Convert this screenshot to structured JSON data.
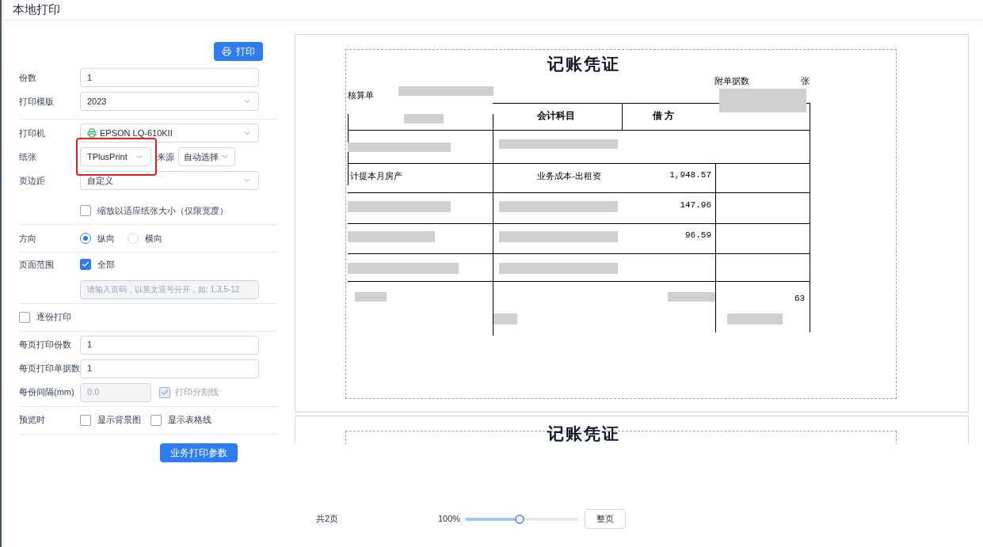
{
  "window": {
    "title": "本地打印"
  },
  "print_button": {
    "label": "打印"
  },
  "groups": [
    [
      {
        "kind": "input",
        "label": "份数",
        "value": "1"
      },
      {
        "kind": "select",
        "label": "打印模版",
        "value": "2023"
      }
    ],
    [
      {
        "kind": "printer",
        "label": "打印机",
        "value": "EPSON LQ-610KII"
      },
      {
        "kind": "paper",
        "label": "纸张",
        "value": "TPlusPrint",
        "highlighted": true,
        "source_label": "来源",
        "source_value": "自动选择"
      },
      {
        "kind": "select",
        "label": "页边距",
        "value": "自定义"
      },
      {
        "kind": "checkbox",
        "label": "缩放以适应纸张大小（仅限宽度）",
        "checked": false
      }
    ],
    [
      {
        "kind": "radio",
        "label": "方向",
        "options": [
          {
            "label": "纵向",
            "selected": true
          },
          {
            "label": "横向",
            "selected": false
          }
        ]
      }
    ],
    [
      {
        "kind": "range",
        "label": "页面范围",
        "option": "全部",
        "checked": true,
        "placeholder": "请输入页码，以英文逗号分开，如: 1,3,5-12",
        "disabled": true
      }
    ],
    [
      {
        "kind": "standalone_checkbox",
        "label": "逐份打印",
        "checked": false
      }
    ],
    [
      {
        "kind": "input",
        "label": "每页打印份数",
        "value": "1"
      },
      {
        "kind": "input",
        "label": "每页打印单据数",
        "value": "1"
      },
      {
        "kind": "interval",
        "label": "每份间隔(mm)",
        "value": "0.0",
        "disabled": true,
        "option": "打印分割线",
        "checked": true
      }
    ],
    [
      {
        "kind": "checks",
        "label": "预览时",
        "options": [
          {
            "label": "显示背景图",
            "checked": false
          },
          {
            "label": "显示表格线",
            "checked": false
          }
        ]
      }
    ]
  ],
  "business_button": {
    "label": "业务打印参数"
  },
  "preview": {
    "pages": [
      {
        "title": "记账凭证",
        "unit_label": "核算单",
        "attachments_label": "附单据数",
        "attachments_unit": "张",
        "columns": [
          "会计科目",
          "借 方"
        ],
        "summary": "计提本月房产",
        "account": "业务成本-出租资",
        "amounts": [
          "1,948.57",
          "147.96",
          "96.59"
        ],
        "total": "63"
      },
      {
        "title": "记账凭证"
      }
    ]
  },
  "footer": {
    "page_count": "共2页",
    "zoom": "100%",
    "level": 0.48,
    "fit_button": "整页"
  }
}
